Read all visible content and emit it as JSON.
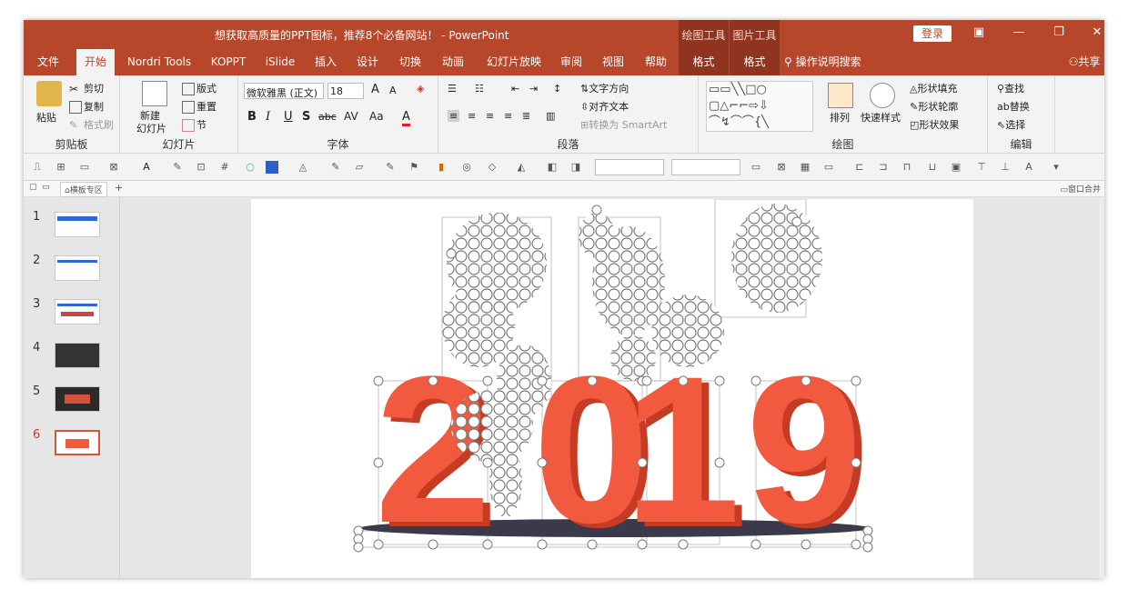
{
  "window": {
    "title": "想获取高质量的PPT图标，推荐8个必备网站！ - PowerPoint"
  },
  "context_groups": {
    "drawing_tools": "绘图工具",
    "picture_tools": "图片工具"
  },
  "login_label": "登录",
  "share_label": "共享",
  "tabs": [
    "文件",
    "开始",
    "Nordri Tools",
    "KOPPT",
    "iSlide",
    "插入",
    "设计",
    "切换",
    "动画",
    "幻灯片放映",
    "审阅",
    "视图",
    "帮助",
    "格式",
    "格式"
  ],
  "tell_me": "操作说明搜索",
  "ribbon": {
    "clipboard": {
      "label": "剪贴板",
      "paste": "粘贴",
      "cut": "剪切",
      "copy": "复制",
      "format_painter": "格式刷"
    },
    "slides": {
      "label": "幻灯片",
      "new_slide_1": "新建",
      "new_slide_2": "幻灯片",
      "layout": "版式",
      "reset": "重置",
      "section": "节"
    },
    "font": {
      "label": "字体",
      "font_name": "微软雅黑 (正文)",
      "font_size": "18"
    },
    "paragraph": {
      "label": "段落",
      "text_direction": "文字方向",
      "align_text": "对齐文本",
      "smartart": "转换为 SmartArt"
    },
    "drawing": {
      "label": "绘图",
      "arrange": "排列",
      "quick_styles": "快速样式",
      "fill": "形状填充",
      "outline": "形状轮廓",
      "effects": "形状效果"
    },
    "editing": {
      "label": "编辑",
      "find": "查找",
      "replace": "替换",
      "select": "选择"
    }
  },
  "docbar": {
    "tab": "横板专区",
    "right": "窗口合并"
  },
  "slides": [
    {
      "num": "1"
    },
    {
      "num": "2"
    },
    {
      "num": "3"
    },
    {
      "num": "4"
    },
    {
      "num": "5"
    },
    {
      "num": "6"
    }
  ],
  "slide": {
    "big_text": "2019",
    "digits": [
      "2",
      "0",
      "1",
      "9"
    ],
    "color": "#f15a3f",
    "shadow_color": "#c63b24",
    "ellipse_color": "#3a3a4a"
  },
  "colors": {
    "accent": "#b7472a",
    "accent_dark": "#8f341f"
  }
}
